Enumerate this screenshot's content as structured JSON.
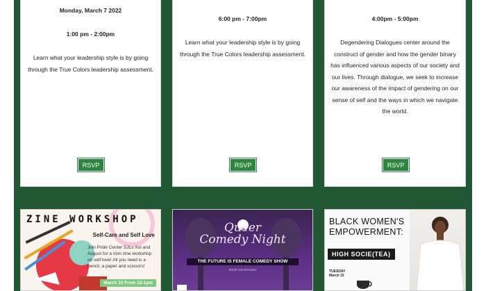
{
  "cards": [
    {
      "date": "Monday, March 7 2022",
      "time": "1:00 pm - 2:00pm",
      "description": "Learn what your leadership style is by going through the True Colors leadership assessment.",
      "button": "RSVP"
    },
    {
      "date": "",
      "time": "6:00 pm - 7:00pm",
      "description": "Learn what your leadership style is by going through the True Colors leadership assessment.",
      "button": "RSVP"
    },
    {
      "date": "",
      "time": "4:00pm - 5:00pm",
      "description": "Degendering Dialogues center around the construct of gender and how the gender binary has influenced various aspects of our society and our lives. Through dialogue, we seek to increase our awareness of the impact of gendering on our sense of self and the ways in which we navigate the world.",
      "button": "RSVP"
    }
  ],
  "thumbnails": {
    "zine": {
      "title": "ZINE WORKSHOP",
      "subtitle": "Self-Care and Self Love",
      "body": "Join Pride Center SJLs Xol and August for a mini zine workshop on self love! All you need is a pencil, a paper and scissors!",
      "when": "March 10 From 12-1pm"
    },
    "queer": {
      "title_line1": "Queer",
      "title_line2": "Comedy Night",
      "banner": "THE FUTURE IS FEMALE COMEDY SHOW",
      "small": "RSVP ON MYSJSU"
    },
    "bwe": {
      "title": "BLACK WOMEN'S EMPOWERMENT:",
      "tag": "HIGH SOCIE(TEA)",
      "day": "TUESDAY",
      "date": "March 15"
    }
  },
  "colors": {
    "panel": "#215732",
    "rsvp": "#2e8540"
  }
}
